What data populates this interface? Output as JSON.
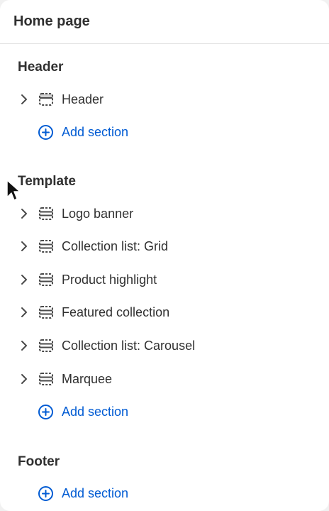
{
  "panel": {
    "title": "Home page"
  },
  "colors": {
    "link": "#005bd3",
    "text": "#303030",
    "icon": "#4a4a4a",
    "divider": "#e3e3e3"
  },
  "groups": {
    "header": {
      "title": "Header",
      "items": [
        {
          "label": "Header",
          "icon": "header-section-icon"
        }
      ],
      "add_label": "Add section"
    },
    "template": {
      "title": "Template",
      "items": [
        {
          "label": "Logo banner",
          "icon": "section-icon"
        },
        {
          "label": "Collection list: Grid",
          "icon": "section-icon"
        },
        {
          "label": "Product highlight",
          "icon": "section-icon"
        },
        {
          "label": "Featured collection",
          "icon": "section-icon"
        },
        {
          "label": "Collection list: Carousel",
          "icon": "section-icon"
        },
        {
          "label": "Marquee",
          "icon": "section-icon"
        }
      ],
      "add_label": "Add section"
    },
    "footer": {
      "title": "Footer",
      "add_label": "Add section"
    }
  }
}
